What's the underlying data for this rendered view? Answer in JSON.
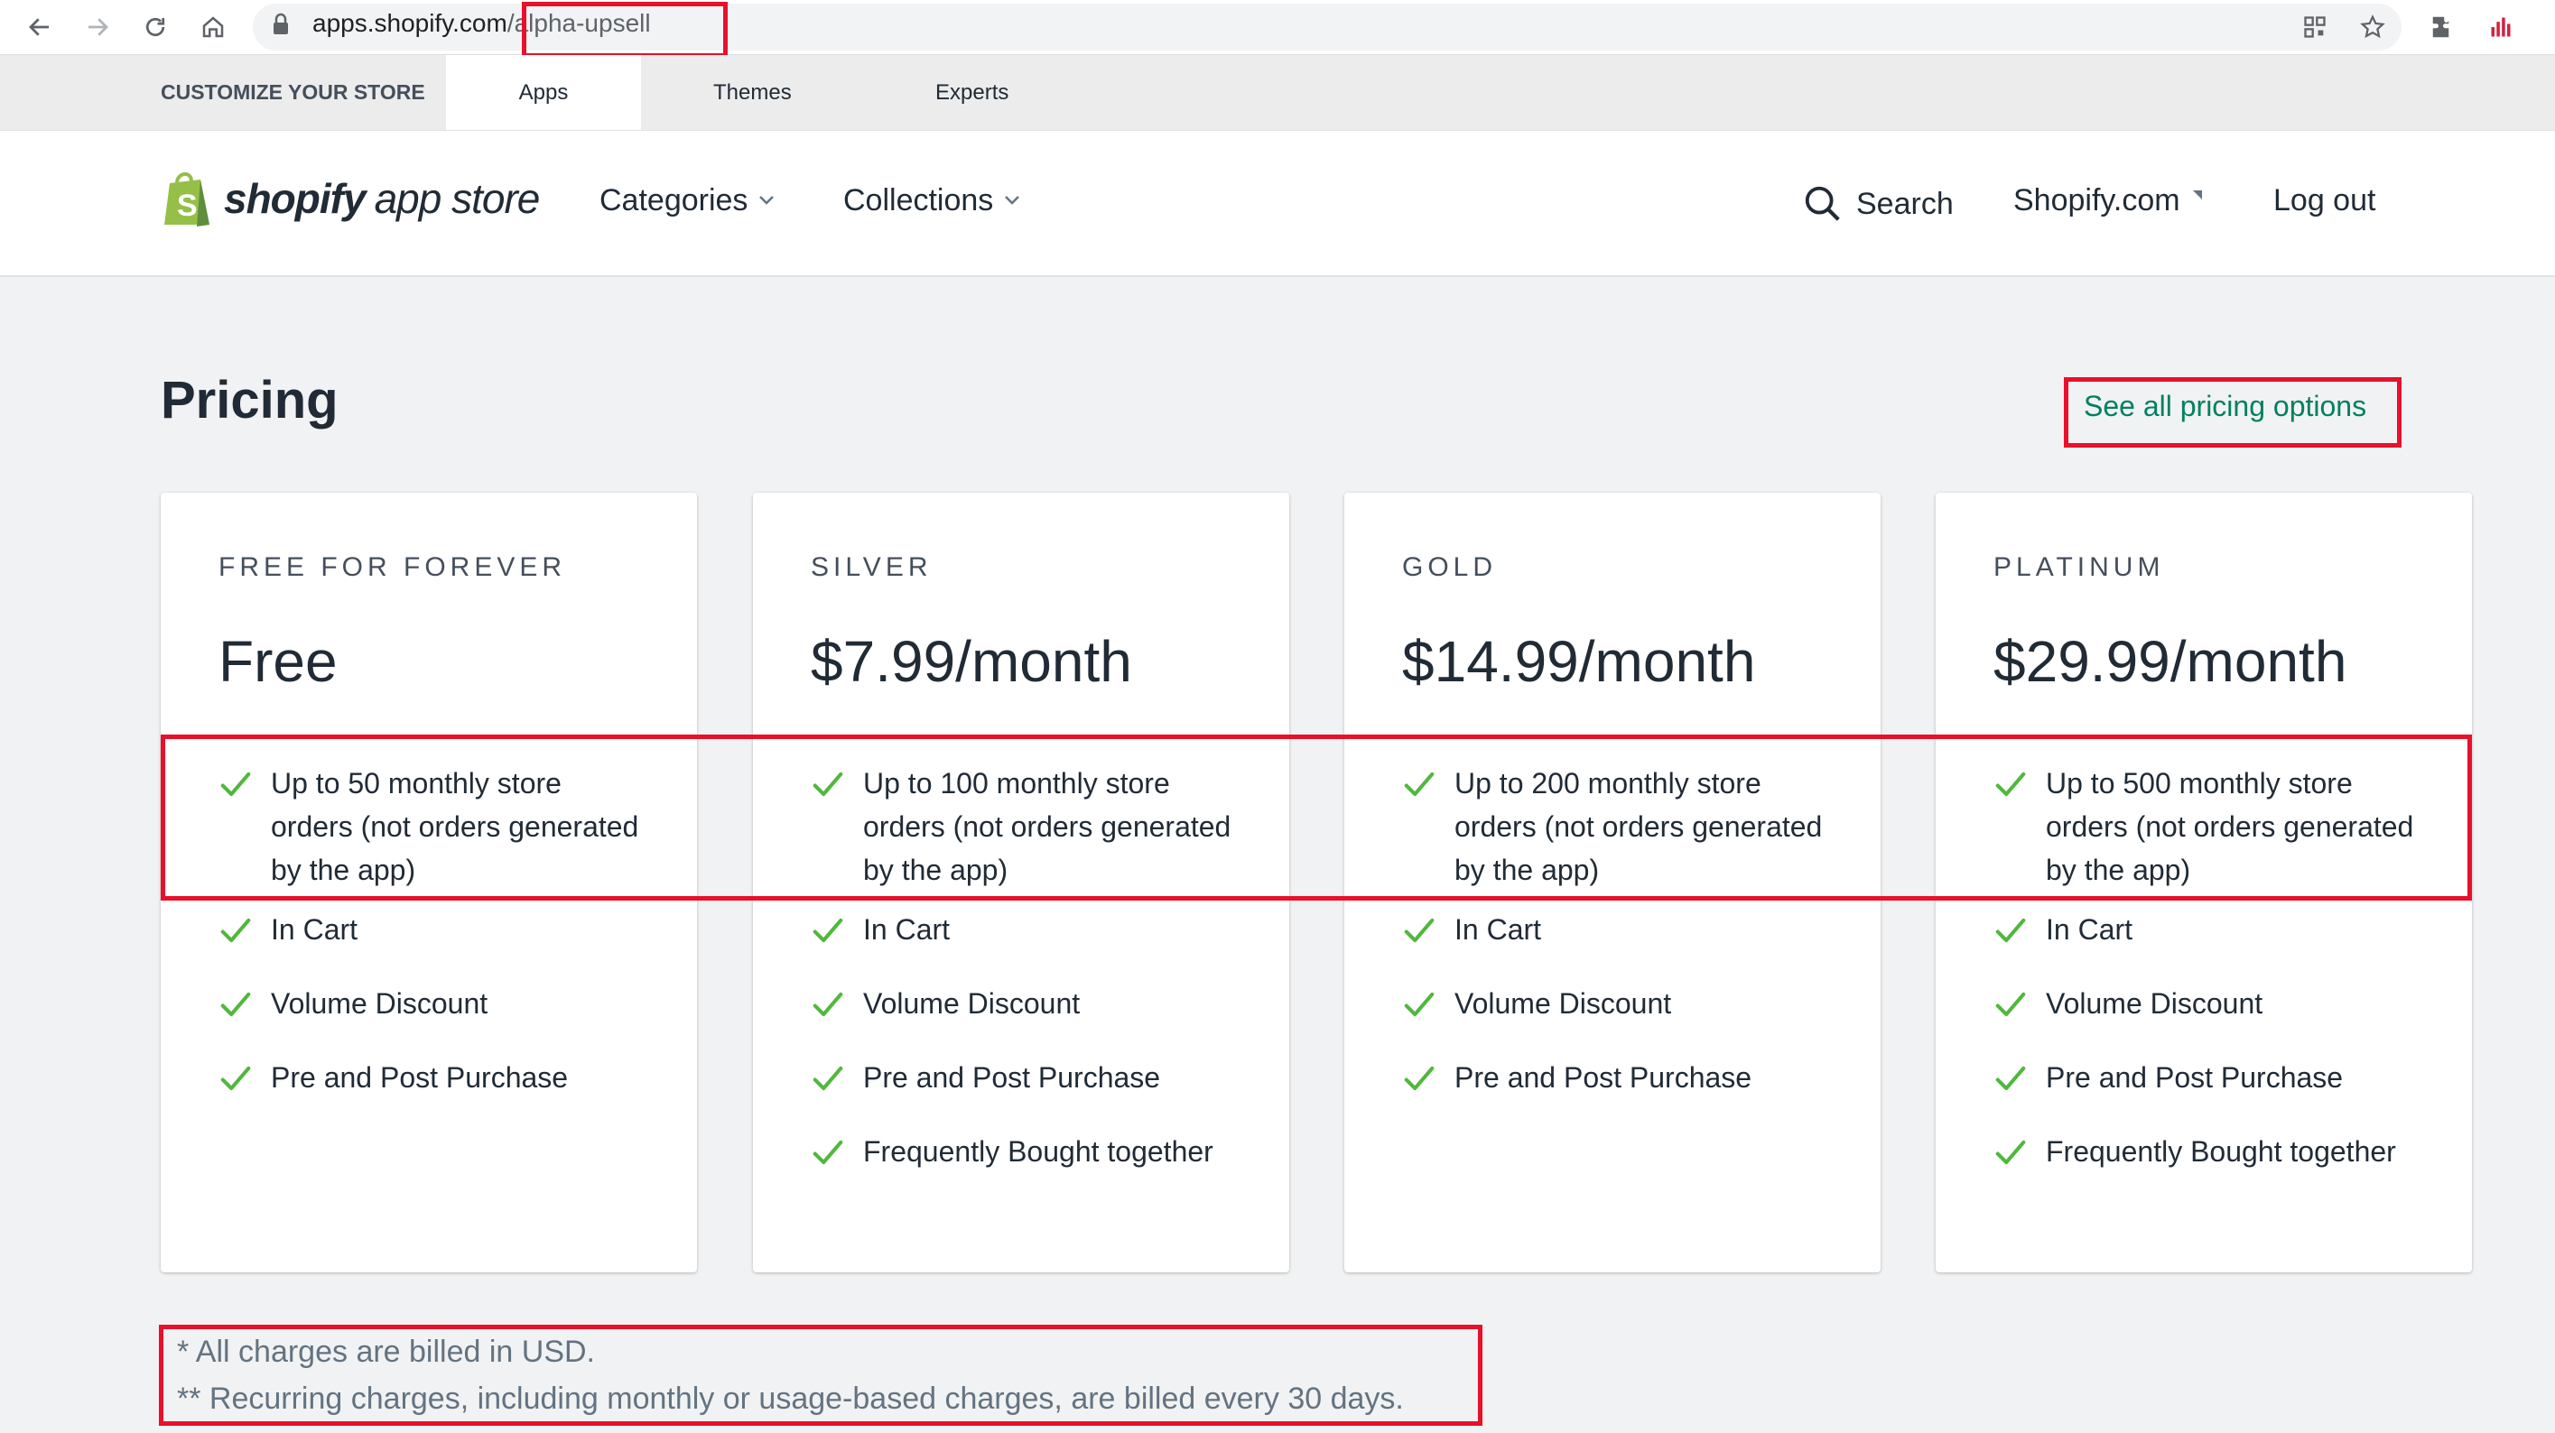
{
  "browser": {
    "url_host": "apps.shopify.com",
    "url_path": "/alpha-upsell"
  },
  "tabstrip": {
    "customize": "CUSTOMIZE YOUR STORE",
    "apps": "Apps",
    "themes": "Themes",
    "experts": "Experts"
  },
  "header": {
    "logo_bold": "shopify",
    "logo_light": "app store",
    "categories": "Categories",
    "collections": "Collections",
    "search": "Search",
    "shopify_com": "Shopify.com",
    "logout": "Log out"
  },
  "pricing": {
    "title": "Pricing",
    "see_all": "See all pricing options",
    "plans": [
      {
        "name": "FREE FOR FOREVER",
        "price": "Free",
        "features": [
          "Up to 50 monthly store orders (not orders generated by the app)",
          "In Cart",
          "Volume Discount",
          "Pre and Post Purchase"
        ]
      },
      {
        "name": "SILVER",
        "price": "$7.99/month",
        "features": [
          "Up to 100 monthly store orders (not orders generated by the app)",
          "In Cart",
          "Volume Discount",
          "Pre and Post Purchase",
          "Frequently Bought together"
        ]
      },
      {
        "name": "GOLD",
        "price": "$14.99/month",
        "features": [
          "Up to 200 monthly store orders (not orders generated by the app)",
          "In Cart",
          "Volume Discount",
          "Pre and Post Purchase"
        ]
      },
      {
        "name": "PLATINUM",
        "price": "$29.99/month",
        "features": [
          "Up to 500 monthly store orders (not orders generated by the app)",
          "In Cart",
          "Volume Discount",
          "Pre and Post Purchase",
          "Frequently Bought together"
        ]
      }
    ],
    "footnote_1": "* All charges are billed in USD.",
    "footnote_2": "** Recurring charges, including monthly or usage-based charges, are billed every 30 days."
  },
  "colors": {
    "accent_green": "#008060",
    "check_green": "#50b83c",
    "highlight_red": "#e8102a"
  }
}
